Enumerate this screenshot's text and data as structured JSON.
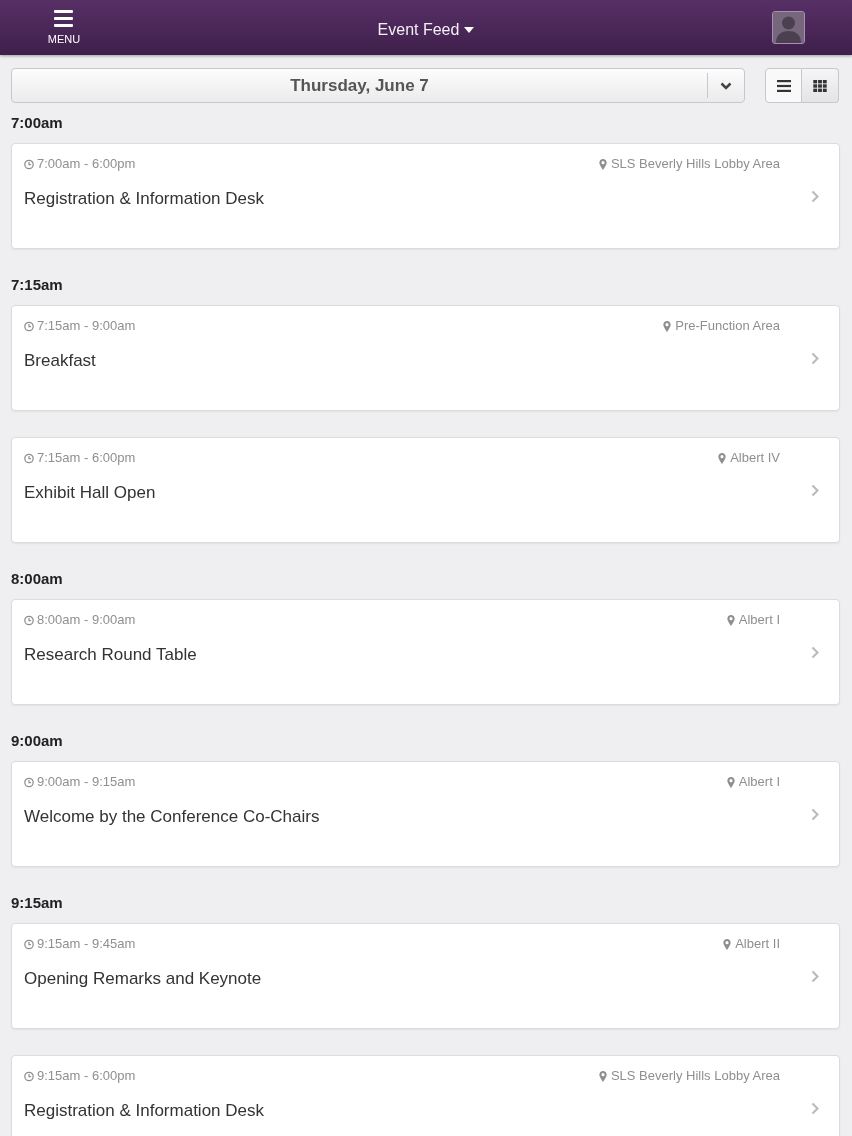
{
  "header": {
    "menu_label": "MENU",
    "title": "Event Feed"
  },
  "date_bar": {
    "date": "Thursday, June 7"
  },
  "view_toggles": [
    {
      "kind": "list",
      "selected": true
    },
    {
      "kind": "grid",
      "selected": false
    }
  ],
  "groups": [
    {
      "time": "7:00am",
      "events": [
        {
          "time_range": "7:00am - 6:00pm",
          "location": "SLS Beverly Hills Lobby Area",
          "title": "Registration & Information Desk"
        }
      ]
    },
    {
      "time": "7:15am",
      "events": [
        {
          "time_range": "7:15am - 9:00am",
          "location": "Pre-Function Area",
          "title": "Breakfast"
        },
        {
          "time_range": "7:15am - 6:00pm",
          "location": "Albert IV",
          "title": "Exhibit Hall Open"
        }
      ]
    },
    {
      "time": "8:00am",
      "events": [
        {
          "time_range": "8:00am - 9:00am",
          "location": "Albert I",
          "title": "Research Round Table"
        }
      ]
    },
    {
      "time": "9:00am",
      "events": [
        {
          "time_range": "9:00am - 9:15am",
          "location": "Albert I",
          "title": "Welcome by the Conference Co-Chairs"
        }
      ]
    },
    {
      "time": "9:15am",
      "events": [
        {
          "time_range": "9:15am - 9:45am",
          "location": "Albert II",
          "title": "Opening Remarks and Keynote"
        },
        {
          "time_range": "9:15am - 6:00pm",
          "location": "SLS Beverly Hills Lobby Area",
          "title": "Registration & Information Desk"
        }
      ]
    }
  ]
}
